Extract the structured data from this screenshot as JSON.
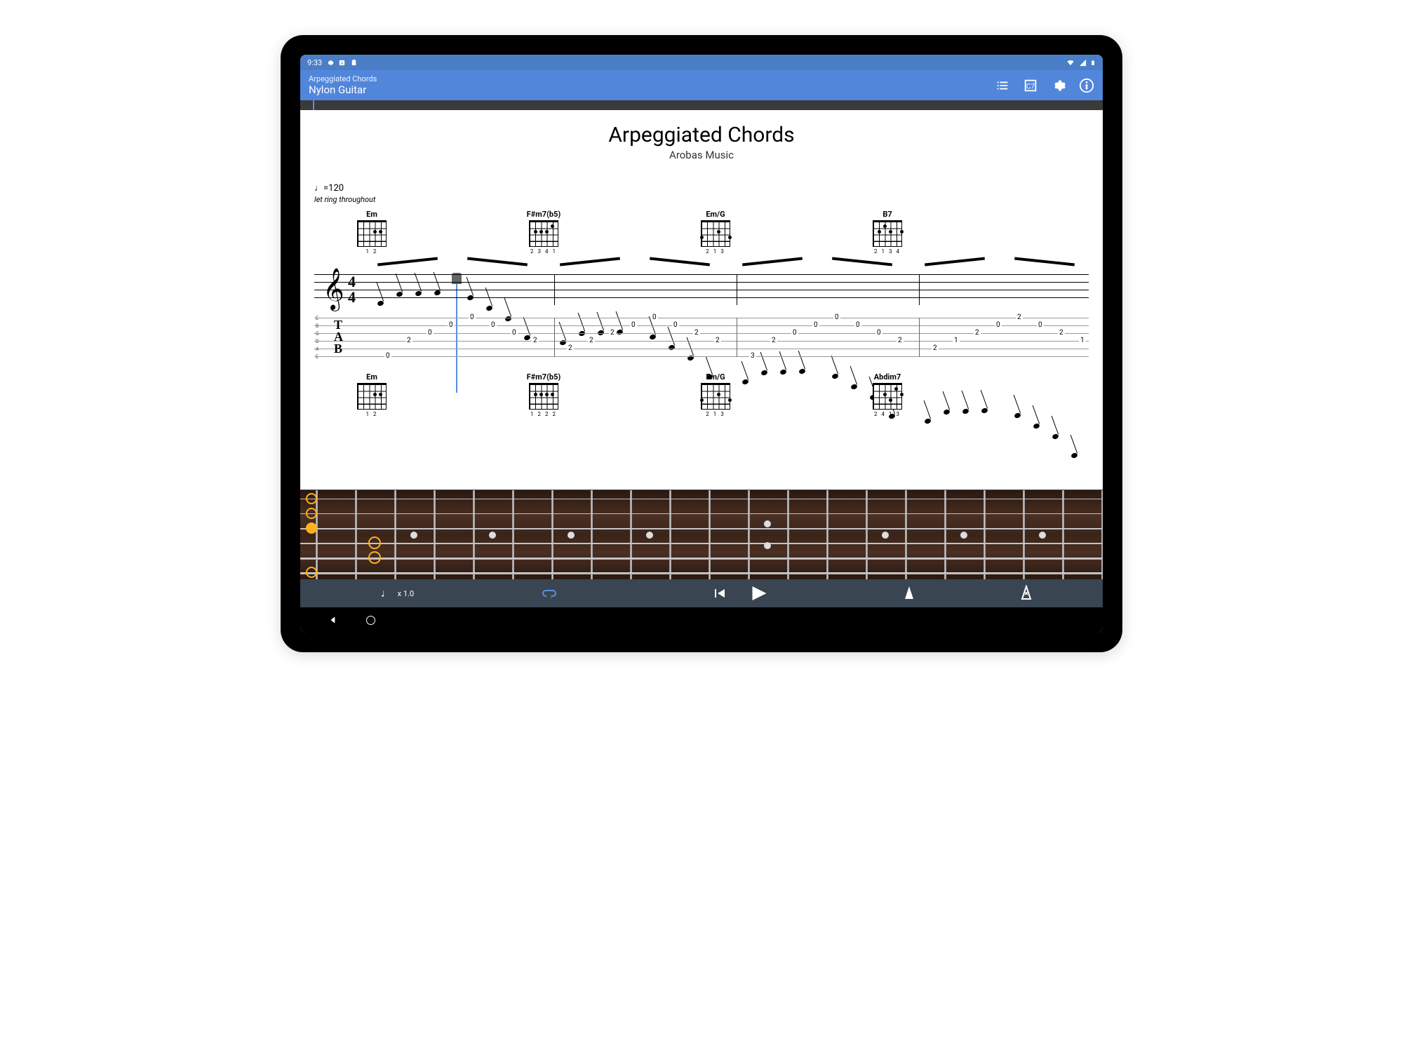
{
  "status_bar": {
    "time": "9:33"
  },
  "app_bar": {
    "title": "Arpeggiated Chords",
    "subtitle": "Nylon Guitar"
  },
  "score": {
    "title": "Arpeggiated Chords",
    "artist": "Arobas Music",
    "tempo": "♩=120",
    "instruction": "let ring throughout",
    "time_signature": {
      "top": "4",
      "bottom": "4"
    },
    "string_labels": [
      "E",
      "B",
      "G",
      "D",
      "A",
      "E"
    ]
  },
  "chords_row1": [
    {
      "name": "Em",
      "fingering": "1 2"
    },
    {
      "name": "F#m7(b5)",
      "fingering": "2 3 4 1"
    },
    {
      "name": "Em/G",
      "fingering": "2 1   3"
    },
    {
      "name": "B7",
      "fingering": "2 1 3  4"
    }
  ],
  "chords_row2": [
    {
      "name": "Em",
      "fingering": "1 2"
    },
    {
      "name": "F#m7(b5)",
      "fingering": "1 2 2 2"
    },
    {
      "name": "Em/G",
      "fingering": "2 1   3"
    },
    {
      "name": "Abdim7",
      "fingering": "2 4 1 3"
    }
  ],
  "tab_measures": [
    {
      "notes": [
        [
          5,
          0
        ],
        [
          3,
          2
        ],
        [
          2,
          0
        ],
        [
          1,
          0
        ],
        [
          0,
          0
        ],
        [
          1,
          0
        ],
        [
          2,
          0
        ],
        [
          3,
          2
        ]
      ]
    },
    {
      "notes": [
        [
          4,
          2
        ],
        [
          3,
          2
        ],
        [
          2,
          2
        ],
        [
          1,
          0
        ],
        [
          0,
          0
        ],
        [
          1,
          0
        ],
        [
          2,
          2
        ],
        [
          3,
          2
        ]
      ]
    },
    {
      "notes": [
        [
          5,
          3
        ],
        [
          3,
          2
        ],
        [
          2,
          0
        ],
        [
          1,
          0
        ],
        [
          0,
          0
        ],
        [
          1,
          0
        ],
        [
          2,
          0
        ],
        [
          3,
          2
        ]
      ]
    },
    {
      "notes": [
        [
          4,
          2
        ],
        [
          3,
          1
        ],
        [
          2,
          2
        ],
        [
          1,
          0
        ],
        [
          0,
          2
        ],
        [
          1,
          0
        ],
        [
          2,
          2
        ],
        [
          3,
          1
        ]
      ]
    }
  ],
  "playback": {
    "speed": "x 1.0"
  },
  "colors": {
    "status_bg": "#4a7fc7",
    "appbar_bg": "#5186db",
    "playback_bg": "#3a4552",
    "playhead": "#5a8de0",
    "finger": "#ffb020"
  }
}
